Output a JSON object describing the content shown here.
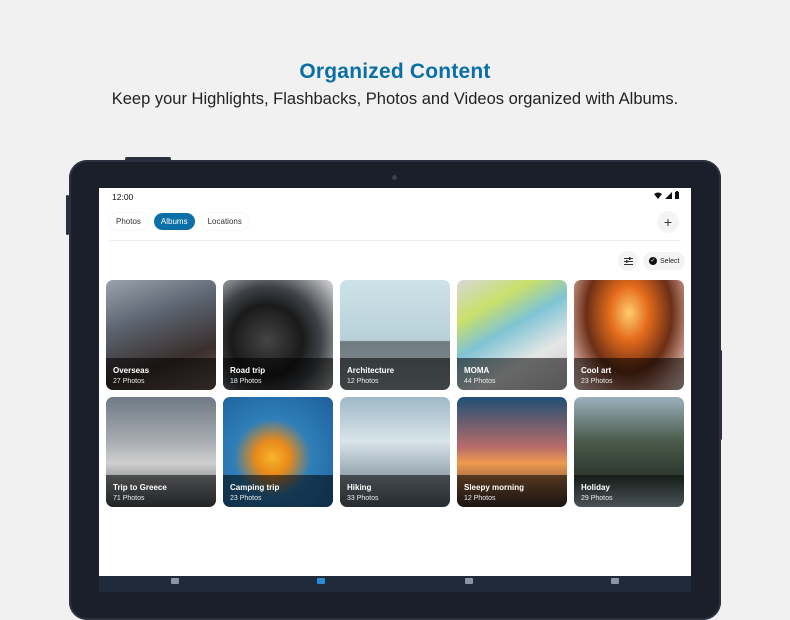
{
  "hero": {
    "title": "Organized Content",
    "subtitle": "Keep your Highlights, Flashbacks, Photos and Videos organized with Albums."
  },
  "status_bar": {
    "time": "12:00"
  },
  "tabs": [
    {
      "label": "Photos",
      "active": false
    },
    {
      "label": "Albums",
      "active": true
    },
    {
      "label": "Locations",
      "active": false
    }
  ],
  "toolbar": {
    "add_icon": "plus-icon",
    "filter_icon": "sliders-icon",
    "select_label": "Select"
  },
  "albums": [
    {
      "name": "Overseas",
      "count": "27 Photos"
    },
    {
      "name": "Road trip",
      "count": "18 Photos"
    },
    {
      "name": "Architecture",
      "count": "12 Photos"
    },
    {
      "name": "MOMA",
      "count": "44 Photos"
    },
    {
      "name": "Cool art",
      "count": "23 Photos"
    },
    {
      "name": "Trip to Greece",
      "count": "71 Photos"
    },
    {
      "name": "Camping trip",
      "count": "23 Photos"
    },
    {
      "name": "Hiking",
      "count": "33 Photos"
    },
    {
      "name": "Sleepy morning",
      "count": "12 Photos"
    },
    {
      "name": "Holiday",
      "count": "29 Photos"
    }
  ],
  "colors": {
    "accent": "#0b6fa8",
    "title": "#0a6fa5",
    "bezel": "#1b1f2a"
  }
}
